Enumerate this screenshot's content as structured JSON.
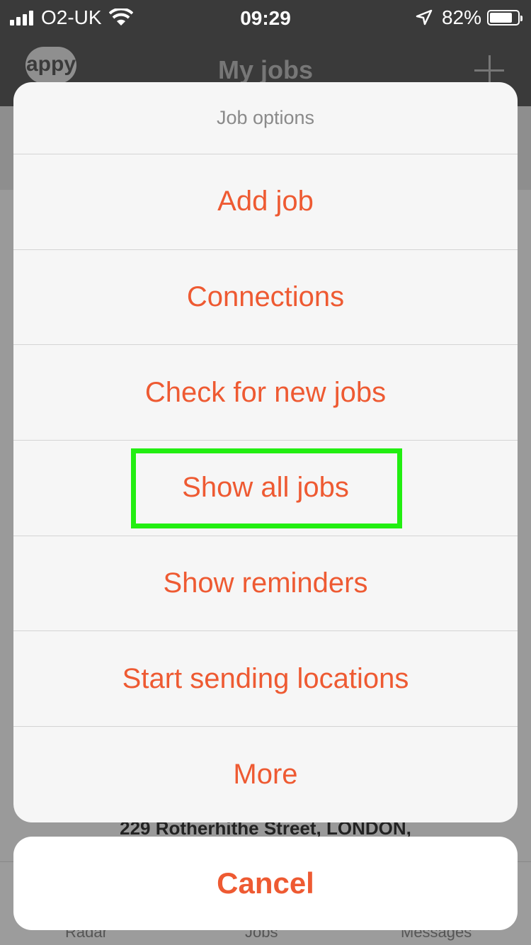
{
  "status_bar": {
    "carrier": "O2-UK",
    "time": "09:29",
    "battery_percent": "82%",
    "battery_level": 0.82
  },
  "nav": {
    "logo": "appy",
    "title": "My jobs"
  },
  "background": {
    "address": "229 Rotherhithe Street, LONDON,"
  },
  "tabs": [
    {
      "label": "Radar"
    },
    {
      "label": "Jobs"
    },
    {
      "label": "Messages"
    }
  ],
  "sheet": {
    "title": "Job options",
    "options": [
      {
        "label": "Add job"
      },
      {
        "label": "Connections"
      },
      {
        "label": "Check for new jobs"
      },
      {
        "label": "Show all jobs"
      },
      {
        "label": "Show reminders"
      },
      {
        "label": "Start sending locations"
      },
      {
        "label": "More"
      }
    ],
    "cancel_label": "Cancel"
  },
  "colors": {
    "accent": "#ee5a32",
    "highlight": "#22ee11"
  }
}
